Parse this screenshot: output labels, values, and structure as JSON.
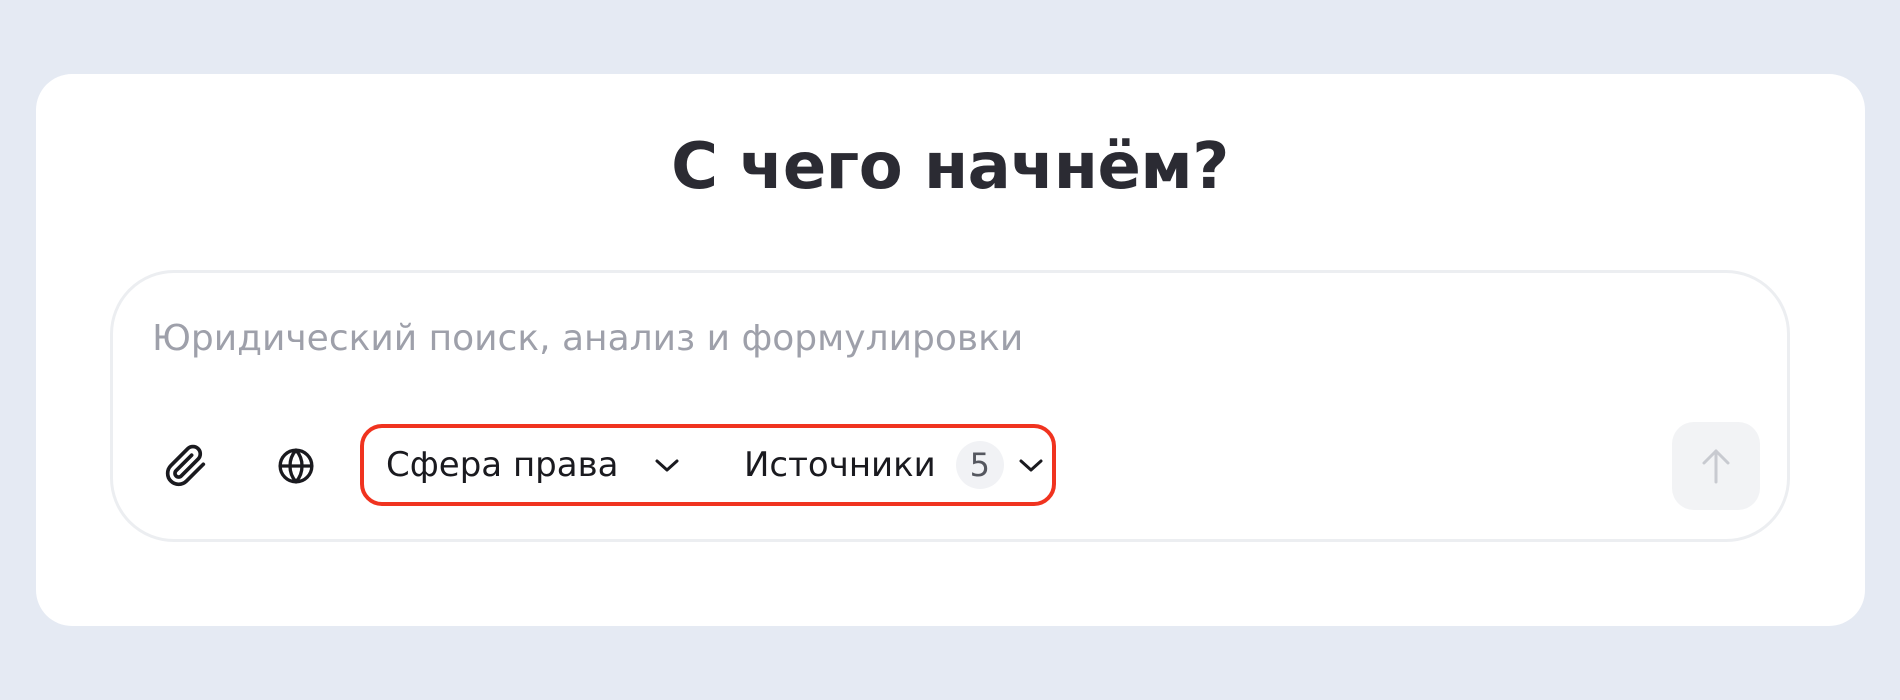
{
  "colors": {
    "background": "#e5eaf3",
    "card": "#ffffff",
    "title_text": "#2b2b33",
    "placeholder_text": "#9ea0aa",
    "highlight_outline": "#f0331f",
    "send_button_bg": "#f2f3f5"
  },
  "heading": {
    "title": "С чего начнём?"
  },
  "composer": {
    "placeholder": "Юридический поиск, анализ и формулировки",
    "attach_icon": "paperclip-icon",
    "web_icon": "globe-icon",
    "send_icon": "arrow-up-icon",
    "send_enabled": false
  },
  "filters": {
    "sphere_label": "Сфера права",
    "sources_label": "Источники",
    "sources_count": "5"
  }
}
